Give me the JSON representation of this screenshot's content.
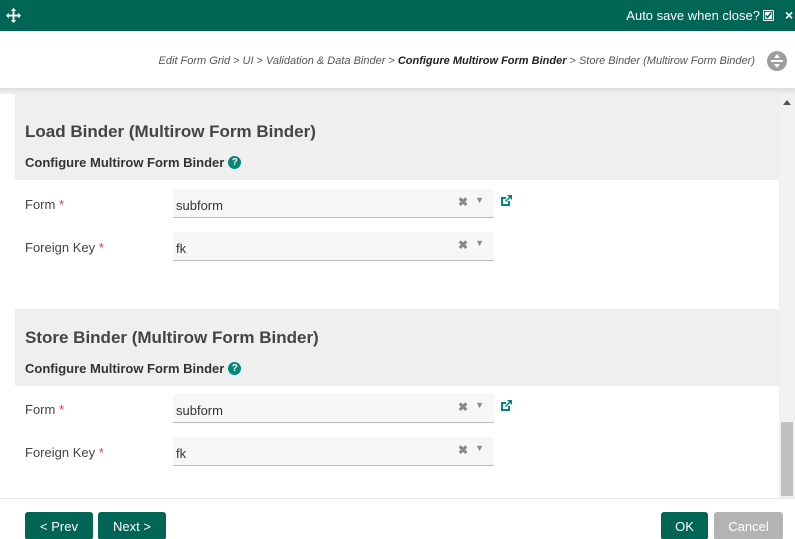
{
  "titlebar": {
    "autosave_label": "Auto save when close?",
    "autosave_checked": true,
    "move_icon": "move-arrows-icon",
    "close_icon": "close-icon"
  },
  "breadcrumb": {
    "items": [
      "Edit Form Grid",
      "UI",
      "Validation & Data Binder"
    ],
    "current": "Configure Multirow Form Binder",
    "last": "Store Binder (Multirow Form Binder)",
    "separator": ">"
  },
  "load_binder": {
    "title": "Load Binder (Multirow Form Binder)",
    "subtitle": "Configure Multirow Form Binder",
    "form_label": "Form",
    "form_value": "subform",
    "fk_label": "Foreign Key",
    "fk_value": "fk"
  },
  "store_binder": {
    "title": "Store Binder (Multirow Form Binder)",
    "subtitle": "Configure Multirow Form Binder",
    "form_label": "Form",
    "form_value": "subform",
    "fk_label": "Foreign Key",
    "fk_value": "fk"
  },
  "common": {
    "required_mark": "*",
    "clear_glyph": "✖",
    "arrow_glyph": "▼",
    "help_glyph": "?"
  },
  "footer": {
    "prev_label": "< Prev",
    "next_label": "Next >",
    "ok_label": "OK",
    "cancel_label": "Cancel"
  },
  "colors": {
    "primary": "#006554",
    "accent": "#00897b",
    "required": "#e53935",
    "disabled": "#b3b3b3"
  }
}
